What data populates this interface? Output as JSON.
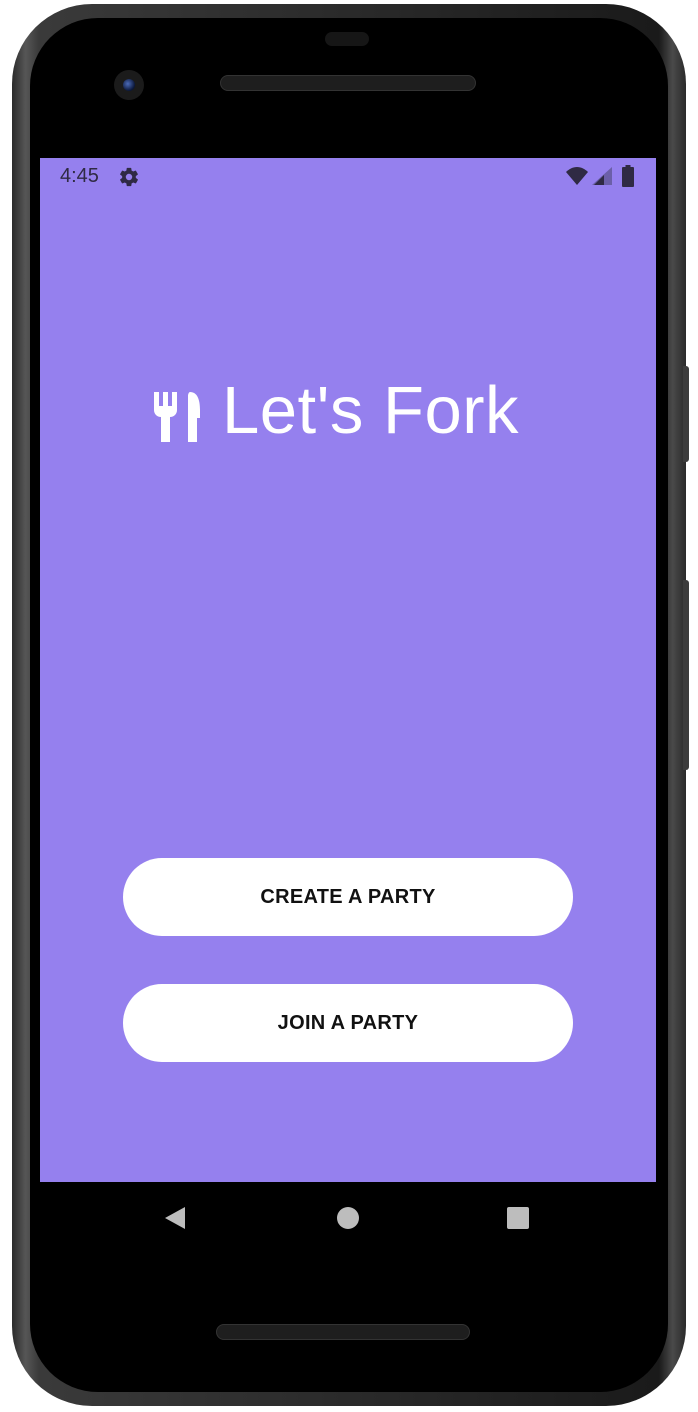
{
  "status_bar": {
    "time": "4:45",
    "icons": [
      "settings-icon",
      "wifi-icon",
      "signal-icon",
      "battery-icon"
    ]
  },
  "app": {
    "title": "Let's Fork",
    "logo_icon": "fork-knife-icon",
    "background_color": "#9580ee",
    "text_color": "#ffffff"
  },
  "actions": {
    "create_label": "CREATE A PARTY",
    "join_label": "JOIN A PARTY"
  },
  "nav_bar": {
    "icons": [
      "back-icon",
      "home-icon",
      "recents-icon"
    ]
  }
}
